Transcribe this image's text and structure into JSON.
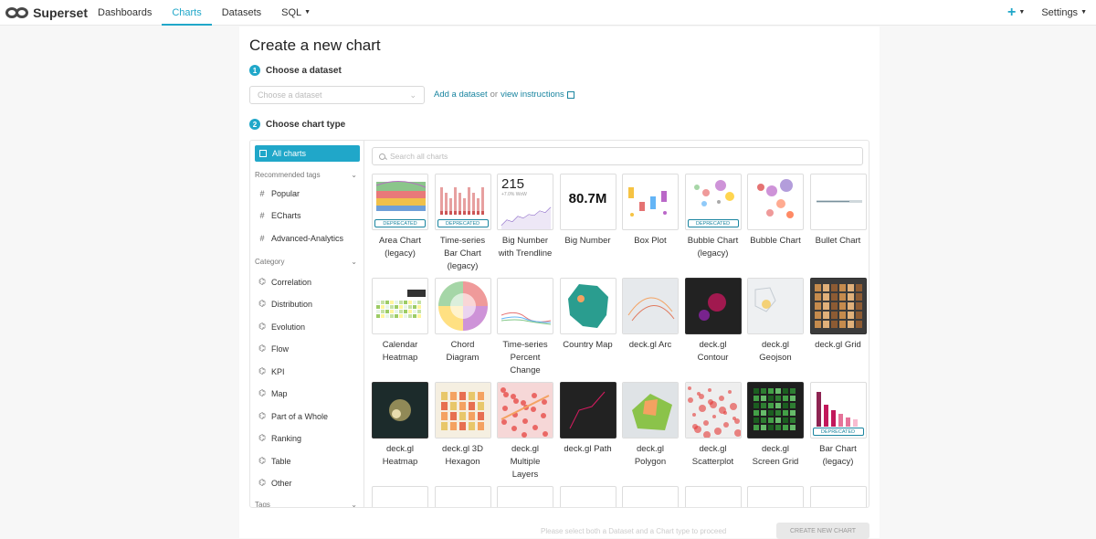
{
  "nav": {
    "brand": "Superset",
    "items": [
      "Dashboards",
      "Charts",
      "Datasets",
      "SQL"
    ],
    "plus": "+",
    "settings": "Settings"
  },
  "page": {
    "title": "Create a new chart",
    "step1": {
      "num": "1",
      "label": "Choose a dataset"
    },
    "dataset_placeholder": "Choose a dataset",
    "add_dataset": "Add a dataset",
    "or": "or",
    "view_instructions": "view instructions",
    "step2": {
      "num": "2",
      "label": "Choose chart type"
    }
  },
  "sidebar": {
    "all": "All charts",
    "recommended_head": "Recommended tags",
    "recommended": [
      "Popular",
      "ECharts",
      "Advanced-Analytics"
    ],
    "category_head": "Category",
    "categories": [
      "Correlation",
      "Distribution",
      "Evolution",
      "Flow",
      "KPI",
      "Map",
      "Part of a Whole",
      "Ranking",
      "Table",
      "Other"
    ],
    "tags_head": "Tags"
  },
  "search_placeholder": "Search all charts",
  "deprecated_label": "DEPRECATED",
  "charts": [
    {
      "l1": "Area Chart",
      "l2": "(legacy)",
      "l3": "",
      "dep": true
    },
    {
      "l1": "Time-series",
      "l2": "Bar Chart",
      "l3": "(legacy)",
      "dep": true
    },
    {
      "l1": "Big Number",
      "l2": "with Trendline",
      "l3": "",
      "dep": false
    },
    {
      "l1": "Big Number",
      "l2": "",
      "l3": "",
      "dep": false
    },
    {
      "l1": "Box Plot",
      "l2": "",
      "l3": "",
      "dep": false
    },
    {
      "l1": "Bubble Chart",
      "l2": "(legacy)",
      "l3": "",
      "dep": true
    },
    {
      "l1": "Bubble Chart",
      "l2": "",
      "l3": "",
      "dep": false
    },
    {
      "l1": "Bullet Chart",
      "l2": "",
      "l3": "",
      "dep": false
    },
    {
      "l1": "Calendar",
      "l2": "Heatmap",
      "l3": "",
      "dep": false
    },
    {
      "l1": "Chord",
      "l2": "Diagram",
      "l3": "",
      "dep": false
    },
    {
      "l1": "Time-series",
      "l2": "Percent",
      "l3": "Change",
      "dep": false
    },
    {
      "l1": "Country Map",
      "l2": "",
      "l3": "",
      "dep": false
    },
    {
      "l1": "deck.gl Arc",
      "l2": "",
      "l3": "",
      "dep": false
    },
    {
      "l1": "deck.gl",
      "l2": "Contour",
      "l3": "",
      "dep": false
    },
    {
      "l1": "deck.gl",
      "l2": "Geojson",
      "l3": "",
      "dep": false
    },
    {
      "l1": "deck.gl Grid",
      "l2": "",
      "l3": "",
      "dep": false
    },
    {
      "l1": "deck.gl",
      "l2": "Heatmap",
      "l3": "",
      "dep": false
    },
    {
      "l1": "deck.gl 3D",
      "l2": "Hexagon",
      "l3": "",
      "dep": false
    },
    {
      "l1": "deck.gl",
      "l2": "Multiple",
      "l3": "Layers",
      "dep": false
    },
    {
      "l1": "deck.gl Path",
      "l2": "",
      "l3": "",
      "dep": false
    },
    {
      "l1": "deck.gl",
      "l2": "Polygon",
      "l3": "",
      "dep": false
    },
    {
      "l1": "deck.gl",
      "l2": "Scatterplot",
      "l3": "",
      "dep": false
    },
    {
      "l1": "deck.gl",
      "l2": "Screen Grid",
      "l3": "",
      "dep": false
    },
    {
      "l1": "Bar Chart",
      "l2": "(legacy)",
      "l3": "",
      "dep": true
    }
  ],
  "bignumber_trend": {
    "value": "215",
    "sub": "+7.0% WoW"
  },
  "bignumber": {
    "value": "80.7M"
  },
  "footer": {
    "create_button": "CREATE NEW CHART",
    "note": "Please select both a Dataset and a Chart type to proceed"
  },
  "colors": {
    "accent": "#20a7c9",
    "link": "#1a85a0"
  }
}
